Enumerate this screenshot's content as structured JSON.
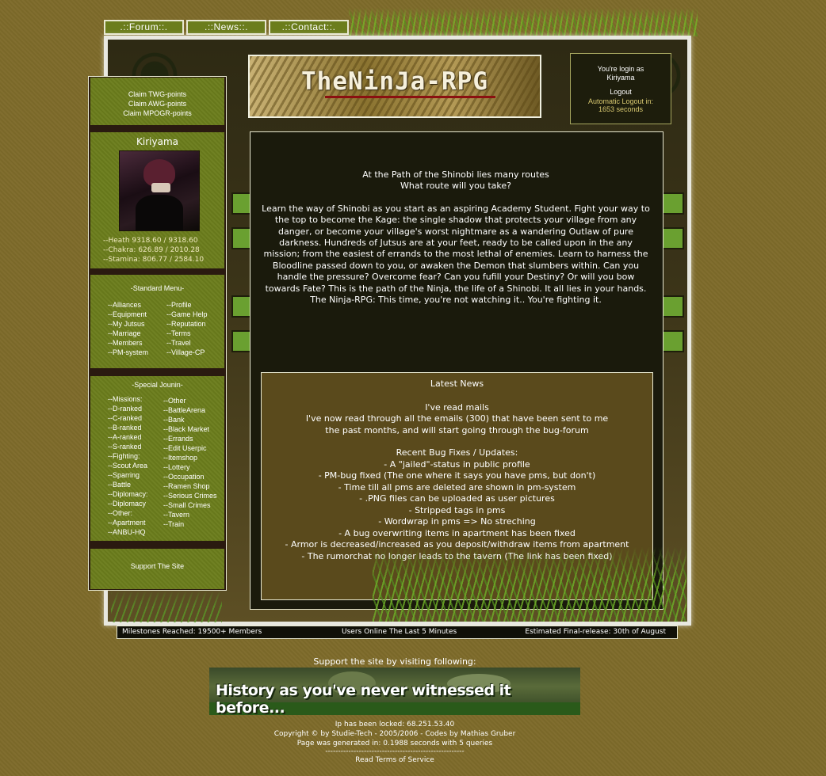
{
  "nav": {
    "tabs": [
      ".::Forum::.",
      ".::News::.",
      ".::Contact::."
    ]
  },
  "logo": {
    "text": "TheNinJa-RPG"
  },
  "login": {
    "line1": "You're login as",
    "user": "Kiriyama",
    "logout": "Logout",
    "auto_label": "Automatic Logout in:",
    "auto_value": "1653 seconds"
  },
  "claims": [
    "Claim TWG-points",
    "Claim AWG-points",
    "Claim MPOGR-points"
  ],
  "profile": {
    "name": "Kiriyama",
    "stats": [
      "--Heath 9318.60 / 9318.60",
      "--Chakra: 626.89 / 2010.28",
      "--Stamina: 806.77 / 2584.10"
    ]
  },
  "standard_menu": {
    "title": "-Standard Menu-",
    "left": [
      "--Alliances",
      "--Equipment",
      "--My Jutsus",
      "--Marriage",
      "--Members",
      "--PM-system"
    ],
    "right": [
      "--Profile",
      "--Game Help",
      "--Reputation",
      "--Terms",
      "--Travel",
      "--Village-CP"
    ]
  },
  "special_menu": {
    "title": "-Special Jounin-",
    "left": [
      "--Missions:",
      "--D-ranked",
      "--C-ranked",
      "--B-ranked",
      "--A-ranked",
      "--S-ranked",
      "--Fighting:",
      "--Scout Area",
      "--Sparring",
      "--Battle",
      "--Diplomacy:",
      "--Diplomacy",
      "--Other:",
      "--Apartment",
      "--ANBU-HQ"
    ],
    "right": [
      "--Other",
      "--BattleArena",
      "--Bank",
      "--Black Market",
      "--Errands",
      "--Edit Userpic",
      "--Itemshop",
      "--Lottery",
      "--Occupation",
      "--Ramen Shop",
      "--Serious Crimes",
      "--Small Crimes",
      "--Tavern",
      "--Train"
    ]
  },
  "support_link": "Support The Site",
  "intro": {
    "line1": "At the Path of the Shinobi lies many routes",
    "line2": "What route will you take?",
    "body": "Learn the way of Shinobi as you start as an aspiring Academy Student. Fight your way to the top to become the Kage: the single shadow that protects your village from any danger, or become your village's worst nightmare as a wandering Outlaw of pure darkness. Hundreds of Jutsus are at your feet, ready to be called upon in the any mission; from the easiest of errands to the most lethal of enemies. Learn to harness the Bloodline passed down to you, or awaken the Demon that slumbers within. Can you handle the pressure? Overcome fear? Can you fufill your Destiny? Or will you bow towards Fate? This is the path of the Ninja, the life of a Shinobi. It all lies in your hands. The Ninja-RPG: This time, you're not watching it.. You're fighting it."
  },
  "news": {
    "title": "Latest News",
    "subtitle": "I've read mails",
    "text1": "I've now read through all the emails (300) that have been sent to me",
    "text2": "the past months, and will start going through the bug-forum",
    "fixes_title": "Recent Bug Fixes / Updates:",
    "fixes": [
      "- A \"jailed\"-status in public profile",
      "- PM-bug fixed (The one where it says you have pms, but don't)",
      "- Time till all pms are deleted are shown in pm-system",
      "- .PNG files can be uploaded as user pictures",
      "- Stripped tags in pms",
      "- Wordwrap in pms => No streching",
      "- A bug overwriting items in apartment has been fixed",
      "- Armor is decreased/increased as you deposit/withdraw items from apartment",
      "- The rumorchat no longer leads to the tavern (The link has been fixed)"
    ]
  },
  "status": {
    "milestones": "Milestones Reached: 19500+ Members",
    "online": "Users Online The Last 5 Minutes",
    "release": "Estimated Final-release: 30th of August"
  },
  "footer": {
    "support_heading": "Support the site by visiting following:",
    "banner_text": "History as you've never witnessed it before...",
    "ip": "Ip has been locked: 68.251.53.40",
    "copyright": "Copyright © by Studie-Tech - 2005/2006 - Codes by Mathias Gruber",
    "generated": "Page was generated in: 0.1988 seconds with 5 queries",
    "divider": "------------------------------------------------------",
    "terms": "Read Terms of Service"
  }
}
